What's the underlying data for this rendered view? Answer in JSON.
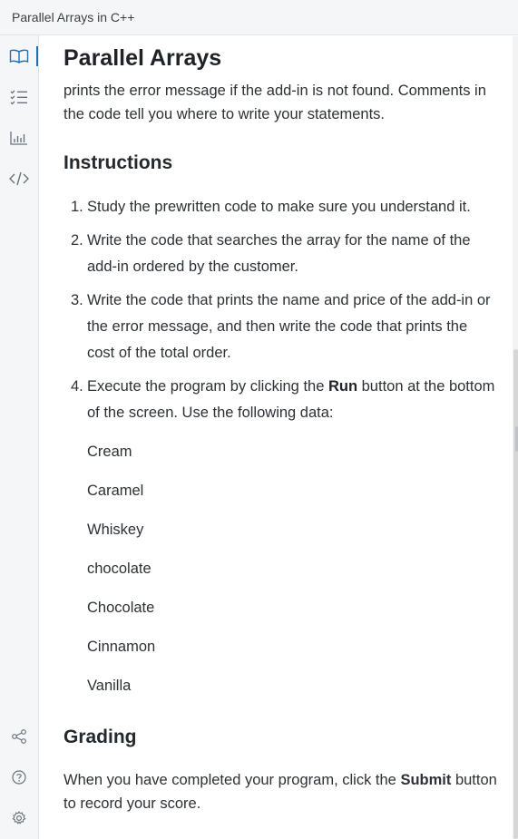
{
  "window": {
    "title": "Parallel Arrays in C++"
  },
  "sidebar": {
    "top_icons": [
      "book-icon",
      "checklist-icon",
      "bar-chart-icon",
      "code-icon"
    ],
    "bottom_icons": [
      "share-icon",
      "help-icon",
      "settings-icon"
    ],
    "active_color": "#1e6fb3"
  },
  "main": {
    "title": "Parallel Arrays",
    "intro": "prints the error message if the add-in is not found. Comments in the code tell you where to write your statements.",
    "instructions_heading": "Instructions",
    "steps": [
      {
        "num": "1.",
        "text": "Study the prewritten code to make sure you understand it."
      },
      {
        "num": "2.",
        "text": "Write the code that searches the array for the name of the add-in ordered by the customer."
      },
      {
        "num": "3.",
        "text": "Write the code that prints the name and price of the add-in or the error message, and then write the code that prints the cost of the total order."
      },
      {
        "num": "4.",
        "text_before": "Execute the program by clicking the ",
        "bold": "Run",
        "text_after": " button at the bottom of the screen. Use the following data:"
      }
    ],
    "data_values": [
      "Cream",
      "Caramel",
      "Whiskey",
      "chocolate",
      "Chocolate",
      "Cinnamon",
      "Vanilla"
    ],
    "grading_heading": "Grading",
    "grading_before": "When you have completed your program, click the ",
    "grading_bold": "Submit",
    "grading_after": " button to record your score."
  }
}
